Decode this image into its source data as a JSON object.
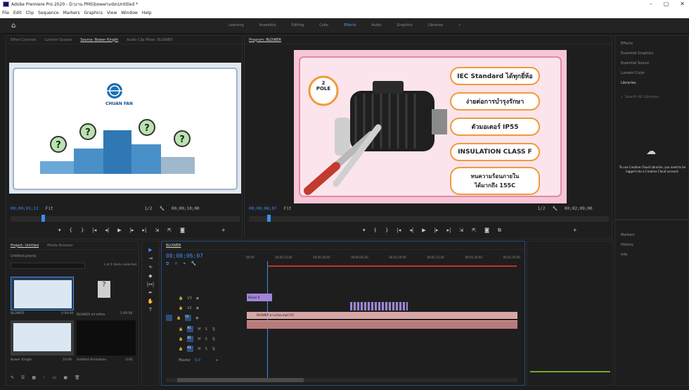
{
  "app": {
    "title": "Adobe Premiere Pro 2020 - D:\\งาน PMS\\bower\\vdo\\Untitled *",
    "window_controls": [
      "–",
      "▢",
      "✕"
    ]
  },
  "menu": [
    "File",
    "Edit",
    "Clip",
    "Sequence",
    "Markers",
    "Graphics",
    "View",
    "Window",
    "Help"
  ],
  "workspaces": {
    "items": [
      "Learning",
      "Assembly",
      "Editing",
      "Color",
      "Effects",
      "Audio",
      "Graphics",
      "Libraries"
    ],
    "active": "Effects",
    "more_icon": "»"
  },
  "source_panel": {
    "tabs": [
      "Effect Controls",
      "Lumetri Scopes",
      "Source: Bower Kingth",
      "Audio Clip Mixer: BLOWER"
    ],
    "selected_tab": "Source: Bower Kingth",
    "timecode": "00;00;01;13",
    "fit": "Fit",
    "page": "1/2",
    "duration": "00;00;10;00",
    "logo_text": "CHUAN FAN"
  },
  "program_panel": {
    "tabs": [
      "Program: BLOWER"
    ],
    "selected_tab": "Program: BLOWER",
    "timecode": "00;00;06;07",
    "fit": "Fit",
    "page": "1/2",
    "duration": "00;02;09;00",
    "badge": "2\nPOLE",
    "features": [
      "IEC Standard ได้ทุกยี่ห้อ",
      "ง่ายต่อการบำรุงรักษา",
      "ตัวมอเตอร์ IP55",
      "INSULATION CLASS F",
      "ทนความร้อนภายใน\nได้มากถึง 155C"
    ]
  },
  "effects_panel": {
    "items": [
      "Effects",
      "Essential Graphics",
      "Essential Sound",
      "Lumetri Color",
      "Libraries"
    ],
    "search_placeholder": "Search All Libraries",
    "cc_message": "To use Creative Cloud Libraries, you need to be logged into a Creative Cloud account.",
    "lower_items": [
      "Markers",
      "History",
      "Info"
    ]
  },
  "project_panel": {
    "tabs": [
      "Project: Untitled",
      "Media Browser"
    ],
    "selected_tab": "Project: Untitled",
    "project_file": "Untitled.prproj",
    "item_count": "1 of 4 items selected",
    "items": [
      {
        "name": "BLOWER",
        "meta": "2:09:00"
      },
      {
        "name": "BLOWER ความร้อน",
        "meta": "1:00:00"
      },
      {
        "name": "Bower Kingth",
        "meta": "10:00"
      },
      {
        "name": "Untitled Animation",
        "meta": "0:01"
      }
    ]
  },
  "timeline": {
    "tab": "BLOWER",
    "timecode": "00;00;06;07",
    "ruler": [
      "00;00",
      "00;00;15;00",
      "00;00;30;00",
      "00;00;45;00",
      "00;01;00;00",
      "00;01;15;00",
      "00;01;30;00",
      "00;01;45;00"
    ],
    "video_tracks": [
      "V3",
      "V2",
      "V1"
    ],
    "audio_tracks": [
      "A1",
      "A2",
      "A3"
    ],
    "master": "Master",
    "master_value": "0.0",
    "clips": {
      "v2": "Bower K",
      "v1": "BLOWER ความร้อน.mp4 [V]"
    }
  },
  "colors": {
    "accent": "#3b8df0",
    "clip_video": "#9f84d8",
    "clip_audio": "#d8a6a6",
    "playhead": "#3b8df0",
    "pill_border": "#f29a3a"
  }
}
